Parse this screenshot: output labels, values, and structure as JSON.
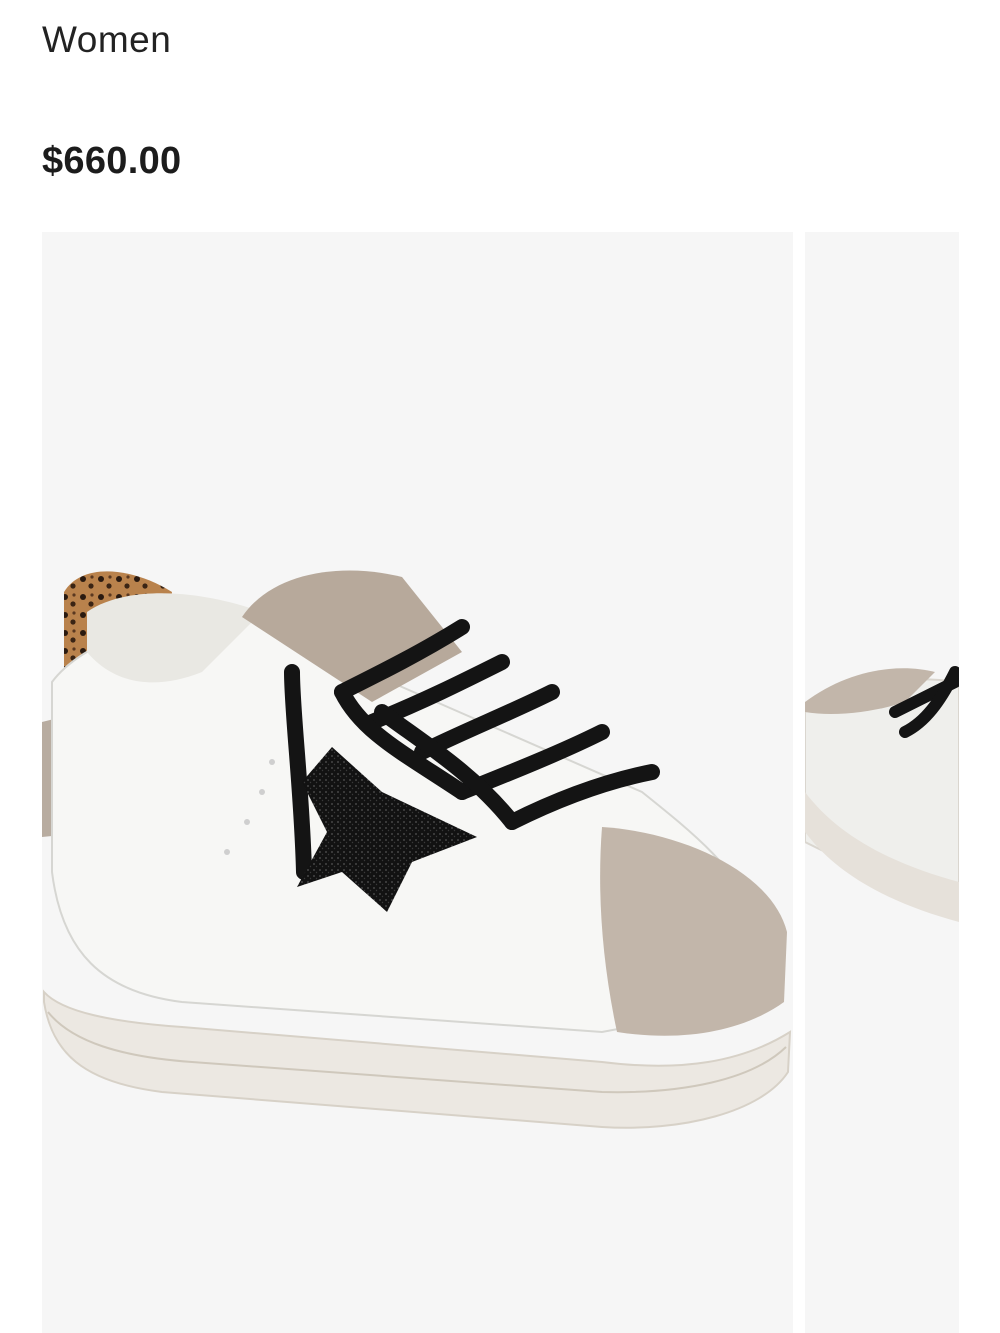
{
  "product": {
    "category": "Women",
    "price": "$660.00"
  },
  "gallery": {
    "images": [
      {
        "name": "product-image-main",
        "icon": "sneaker-side-view"
      },
      {
        "name": "product-image-next",
        "icon": "sneaker-partial-view"
      }
    ]
  },
  "colors": {
    "background": "#ffffff",
    "image_background": "#f6f6f6",
    "text": "#1f1f1f"
  }
}
